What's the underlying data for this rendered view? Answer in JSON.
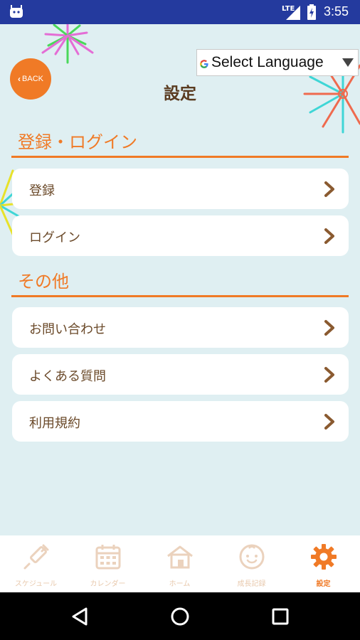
{
  "status_bar": {
    "network": "LTE",
    "time": "3:55"
  },
  "language_selector": {
    "label": "Select Language",
    "arrow": "▼"
  },
  "back_button": {
    "label": "BACK"
  },
  "page_title": "設定",
  "sections": [
    {
      "title": "登録・ログイン",
      "items": [
        "登録",
        "ログイン"
      ]
    },
    {
      "title": "その他",
      "items": [
        "お問い合わせ",
        "よくある質問",
        "利用規約"
      ]
    }
  ],
  "bottom_nav": [
    {
      "label": "スケジュール",
      "icon": "syringe-icon",
      "active": false
    },
    {
      "label": "カレンダー",
      "icon": "calendar-icon",
      "active": false
    },
    {
      "label": "ホーム",
      "icon": "home-icon",
      "active": false
    },
    {
      "label": "成長記録",
      "icon": "baby-face-icon",
      "active": false
    },
    {
      "label": "設定",
      "icon": "gear-icon",
      "active": true
    }
  ],
  "colors": {
    "accent": "#f07a26",
    "status_bar": "#243a9e",
    "background": "#dfeff2",
    "menu_text": "#6b4a2a",
    "inactive_nav": "#e8c9ad"
  }
}
